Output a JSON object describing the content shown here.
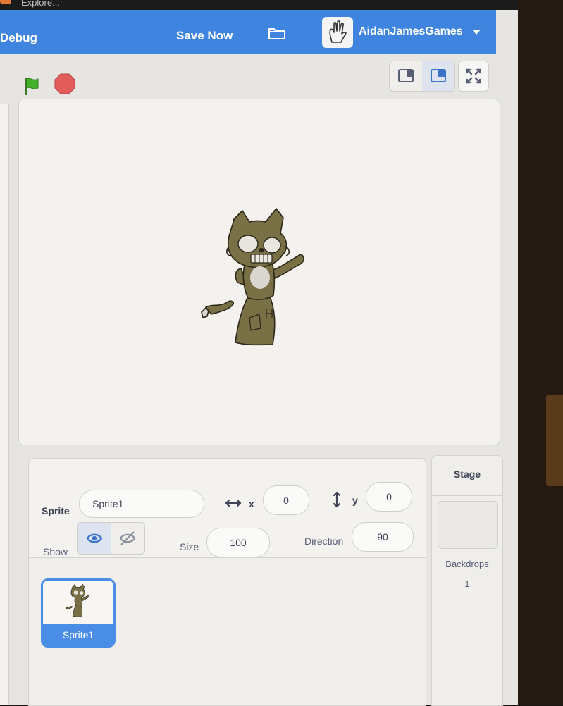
{
  "browser_tab": {
    "label": "Explore..."
  },
  "menubar": {
    "debug_label": "Debug",
    "save_label": "Save Now",
    "folder_icon": "folder-icon",
    "username": "AidanJamesGames"
  },
  "controls": {
    "green_flag_icon": "green-flag-icon",
    "stop_icon": "stop-icon"
  },
  "sprite_info": {
    "sprite_label": "Sprite",
    "sprite_name": "Sprite1",
    "x_label": "x",
    "x_value": "0",
    "y_label": "y",
    "y_value": "0",
    "show_label": "Show",
    "size_label": "Size",
    "size_value": "100",
    "direction_label": "Direction",
    "direction_value": "90"
  },
  "sprites": [
    {
      "name": "Sprite1",
      "selected": true
    }
  ],
  "stage_panel": {
    "title": "Stage",
    "backdrops_label": "Backdrops",
    "backdrops_count": "1"
  },
  "colors": {
    "menu_blue": "#3f84df",
    "selected_blue": "#4a8de6",
    "sprite_olive": "#7a7046"
  }
}
